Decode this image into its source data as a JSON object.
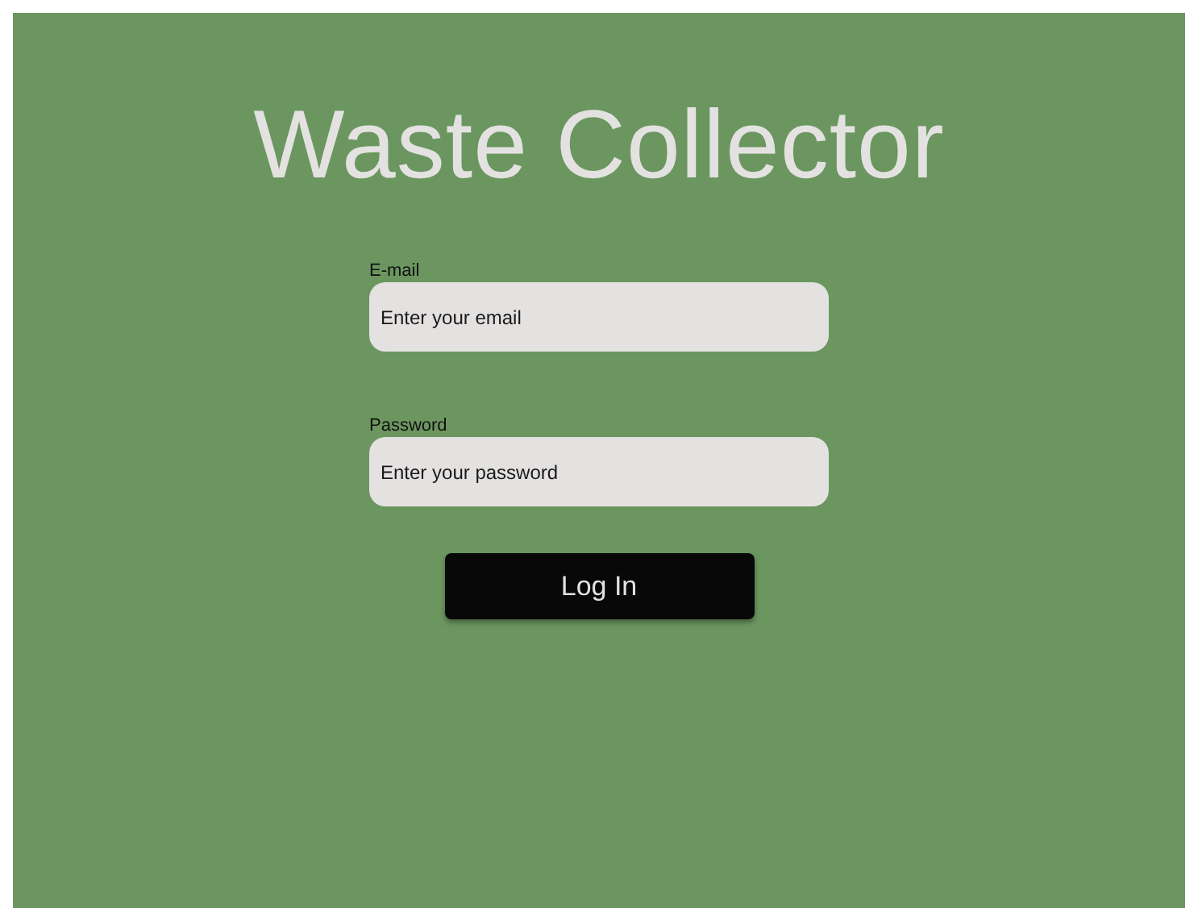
{
  "title": "Waste Collector",
  "fields": [
    {
      "label": "E-mail",
      "placeholder": "Enter your email"
    },
    {
      "label": "Password",
      "placeholder": "Enter your password"
    }
  ],
  "button": "Log In"
}
